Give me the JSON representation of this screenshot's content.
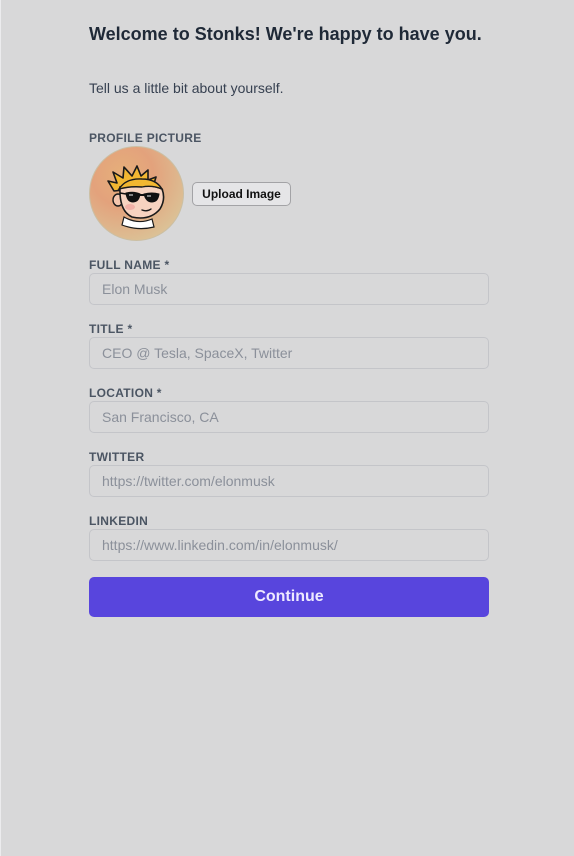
{
  "header": {
    "welcome": "Welcome to Stonks! We're happy to have you.",
    "subtitle": "Tell us a little bit about yourself."
  },
  "profile_picture": {
    "label": "PROFILE PICTURE",
    "upload_label": "Upload Image"
  },
  "fields": {
    "full_name": {
      "label": "FULL NAME *",
      "value": "",
      "placeholder": "Elon Musk"
    },
    "title": {
      "label": "TITLE *",
      "value": "",
      "placeholder": "CEO @ Tesla, SpaceX, Twitter"
    },
    "location": {
      "label": "LOCATION *",
      "value": "",
      "placeholder": "San Francisco, CA"
    },
    "twitter": {
      "label": "TWITTER",
      "value": "",
      "placeholder": "https://twitter.com/elonmusk"
    },
    "linkedin": {
      "label": "LINKEDIN",
      "value": "",
      "placeholder": "https://www.linkedin.com/in/elonmusk/"
    }
  },
  "actions": {
    "continue_label": "Continue"
  },
  "colors": {
    "background": "#d8d8d9",
    "primary_button": "#5845dd",
    "label_text": "#4b5563",
    "placeholder_text": "#8b909a"
  },
  "icons": {
    "avatar": "cartoon-avatar-with-sunglasses"
  }
}
